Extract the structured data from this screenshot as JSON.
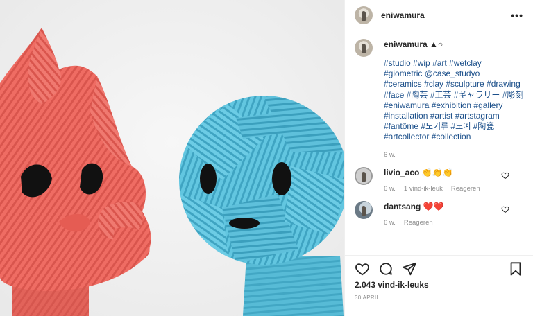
{
  "post": {
    "username": "eniwamura",
    "more_icon": "more-dots-icon"
  },
  "caption": {
    "username": "eniwamura",
    "user_suffix": "▲○",
    "lines": [
      "#studio #wip #art #wetclay",
      "#giometric @case_studyo",
      "#ceramics #clay #sculpture #drawing",
      "#face #陶芸 #工芸 #ギャラリー #彫刻",
      "#eniwamura #exhibition #gallery",
      "#installation #artist #artstagram",
      "#fantôme #도기류 #도예 #陶瓷",
      "#artcollector #collection"
    ],
    "time": "6 w."
  },
  "comments": [
    {
      "username": "livio_aco",
      "text": "👏👏👏",
      "time": "6 w.",
      "likes": "1 vind-ik-leuk",
      "reply": "Reageren"
    },
    {
      "username": "dantsang",
      "text": "❤️❤️",
      "time": "6 w.",
      "reply": "Reageren"
    }
  ],
  "actions": {
    "like_icon": "heart-icon",
    "comment_icon": "comment-icon",
    "share_icon": "paper-plane-icon",
    "save_icon": "bookmark-icon"
  },
  "likes_text": "2.043 vind-ik-leuks",
  "date_text": "30 APRIL",
  "colors": {
    "hashtag": "#1b4f8a",
    "muted": "#8e8e8e",
    "red_sculpture": "#ee6b62",
    "blue_sculpture": "#5fc3dd"
  }
}
